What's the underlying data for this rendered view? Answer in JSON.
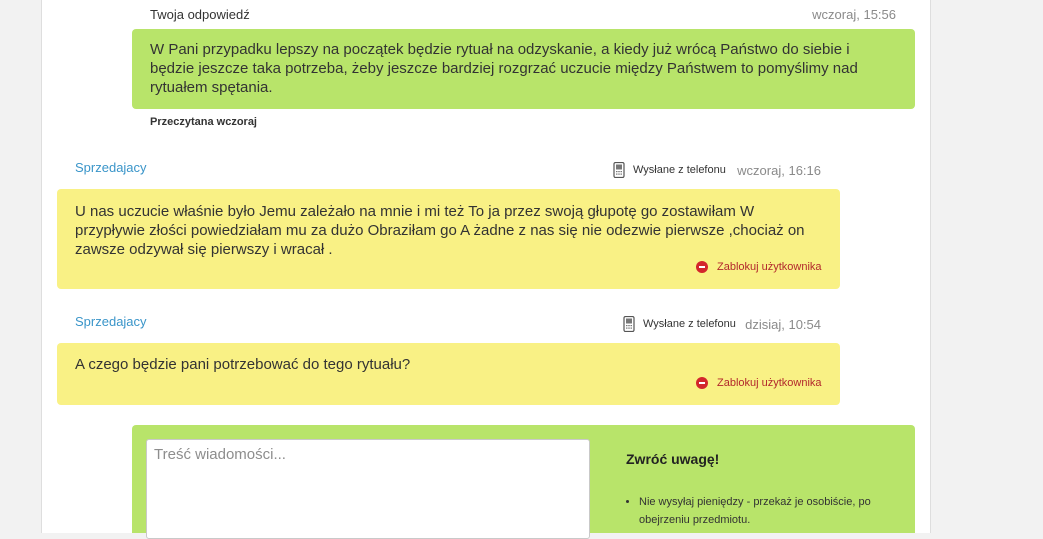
{
  "messages": [
    {
      "author_label": "Twoja odpowiedź",
      "time": "wczoraj, 15:56",
      "text": "W Pani przypadku lepszy na początek będzie rytuał na odzyskanie, a kiedy już wrócą Państwo do siebie i będzie jeszcze taka potrzeba, żeby jeszcze bardziej rozgrzać uczucie między Państwem to pomyślimy nad rytuałem spętania.",
      "status": "Przeczytana wczoraj"
    },
    {
      "sender": "Sprzedajacy",
      "sent_via": "Wysłane z telefonu",
      "time": "wczoraj, 16:16",
      "text": "U nas uczucie właśnie było Jemu zależało na mnie i mi też To ja przez swoją głupotę go zostawiłam W przypływie złości powiedziałam mu za dużo Obraziłam go A żadne z nas się nie odezwie pierwsze ,chociaż on zawsze odzywał się pierwszy i wracał .",
      "block_label": "Zablokuj użytkownika"
    },
    {
      "sender": "Sprzedajacy",
      "sent_via": "Wysłane z telefonu",
      "time": "dzisiaj, 10:54",
      "text": "A czego będzie pani potrzebować do tego rytuału?",
      "block_label": "Zablokuj użytkownika"
    }
  ],
  "compose": {
    "placeholder": "Treść wiadomości...",
    "notice_title": "Zwróć uwagę!",
    "notice_items": [
      "Nie wysyłaj pieniędzy - przekaż je osobiście, po obejrzeniu przedmiotu."
    ]
  },
  "colors": {
    "own_bubble": "#b8e46a",
    "other_bubble": "#f9f185",
    "sender_link": "#3a95c9",
    "block_red": "#d3262c"
  },
  "icons": {
    "phone": "mobile-phone-icon",
    "block": "no-entry-icon"
  }
}
